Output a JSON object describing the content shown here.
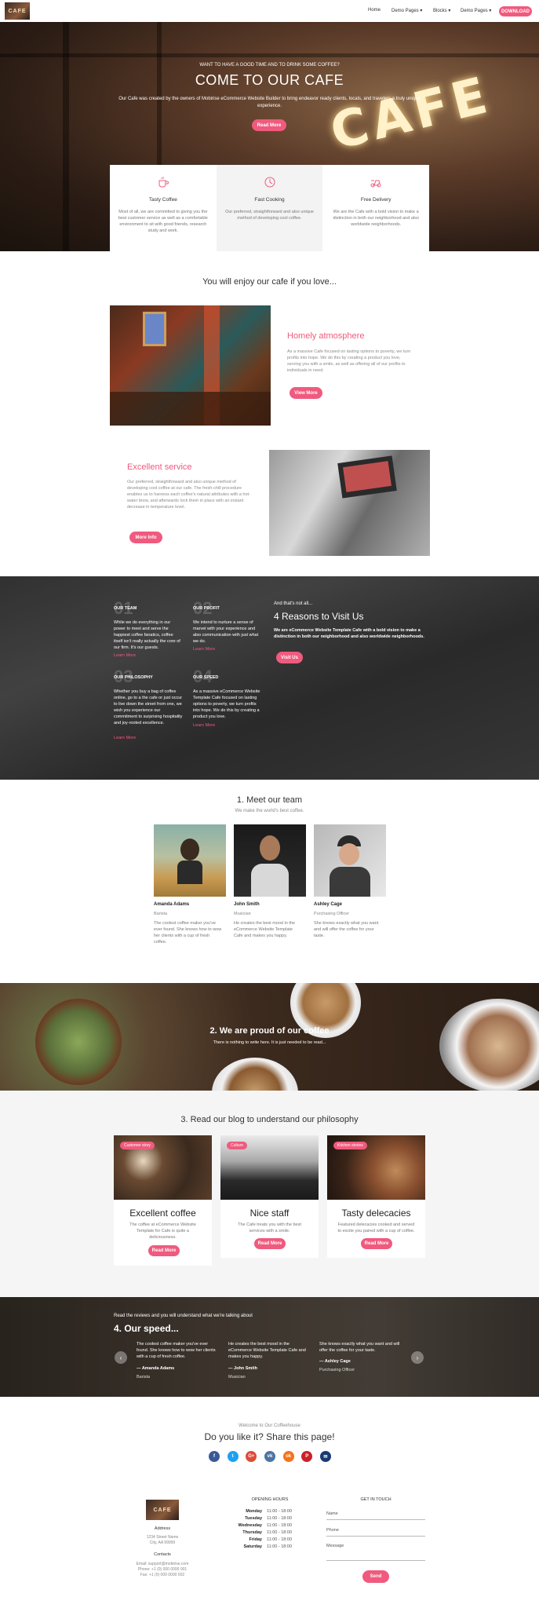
{
  "nav": {
    "logo_text": "CAFE",
    "items": [
      "Home",
      "Demo Pages ▾",
      "Blocks ▾",
      "Demo Pages ▾"
    ],
    "download": "DOWNLOAD"
  },
  "hero": {
    "pre": "WANT TO HAVE A GOOD TIME AND TO DRINK SOME COFFEE?",
    "title": "COME TO OUR CAFE",
    "desc": "Our Cafe was created by the owners of Mobirise eCommerce Website Builder to bring endeavor ready clients, locals, and travelers a truly unique experience.",
    "button": "Read More",
    "sign": "CAFE"
  },
  "features": [
    {
      "title": "Tasty Coffee",
      "text": "Most of all, we are committed to giving you the best customer service as well as a comfortable environment to sit with good friends, research study and work."
    },
    {
      "title": "Fast Cooking",
      "text": "Our preferred, straightforward and also unique method of developing cool coffee."
    },
    {
      "title": "Free Delivery",
      "text": "We are the Cafe with a bold vision to make a distinction in both our neighborhood and also worldwide neighborhoods."
    }
  ],
  "enjoy": {
    "title": "You will enjoy our cafe if you love...",
    "atmos_title": "Homely atmosphere",
    "atmos_text": "As a massive Cafe focused on lasting options to poverty, we turn profits into hope. We do this by creating a product you love, serving you with a smile, as well as offering all of our profits to individuals in need.",
    "atmos_btn": "View More",
    "service_title": "Excellent service",
    "service_text": "Our preferred, straightforward and also unique method of developing cool coffee at our cafe. The fresh-chill procedure enables us to harness each coffee's natural attributes with a hot-water brew, and afterwards lock them in place with an instant decrease in temperature level.",
    "service_btn": "More Info"
  },
  "reasons": {
    "items": [
      {
        "num": "01",
        "head": "OUR TEAM",
        "text": "While we do everything in our power to meet and serve the happiest coffee fanatics, coffee itself isn't really actually the core of our firm. It's our guests.",
        "more": "Learn More"
      },
      {
        "num": "02",
        "head": "OUR PROFIT",
        "text": "We intend to nurture a sense of marvel with your experience and also communication with just what we do.",
        "more": "Learn More"
      },
      {
        "num": "03",
        "head": "OUR PHILOSOPHY",
        "text": "Whether you buy a bag of coffee online, go to a the cafe or just occur to live down the street from one, we wish you experience our commitment to surprising hospitality and joy-rooted excellence.",
        "more": "Learn More"
      },
      {
        "num": "04",
        "head": "OUR SPEED",
        "text": "As a massive eCommerce Website Template Cafe focused on lasting options to poverty, we turn profits into hope. We do this by creating a product you love.",
        "more": "Learn More"
      }
    ],
    "pre": "And that's not all...",
    "title": "4 Reasons to Visit Us",
    "text": "We are eCommerce Website Template Cafe with a bold vision to make a distinction in both our neighborhood and also worldwide neighborhoods.",
    "button": "Visit Us"
  },
  "team": {
    "title": "1. Meet our team",
    "subtitle": "We make the world's best coffee.",
    "members": [
      {
        "name": "Amanda Adams",
        "role": "Barista",
        "text": "The coolest coffee maker you've ever found. She knows how to wow her clients with a cup of fresh coffee."
      },
      {
        "name": "John Smith",
        "role": "Musician",
        "text": "He creates the best mood in the eCommerce Website Template Cafe and makes you happy."
      },
      {
        "name": "Ashley Cage",
        "role": "Purchasing Officer",
        "text": "She knows exactly what you want and will offer the coffee for your taste."
      }
    ]
  },
  "proud": {
    "title": "2. We are proud of our coffee",
    "subtitle": "There is nothing to write here. It is just needed to be read..."
  },
  "blog": {
    "title": "3. Read our blog to understand our philosophy",
    "cards": [
      {
        "tag": "Customer story",
        "title": "Excellent coffee",
        "text": "The coffee at eCommerce Website Template for Cafe is quite a deliciousness.",
        "button": "Read More"
      },
      {
        "tag": "Culture",
        "title": "Nice staff",
        "text": "The Cafe treats you with the best services with a smile.",
        "button": "Read More"
      },
      {
        "tag": "Kitchen stories",
        "title": "Tasty delecacies",
        "text": "Featured delecacies cooked and served to excite you paired with a cup of coffee.",
        "button": "Read More"
      }
    ]
  },
  "speed": {
    "pre": "Read the reviews and you will understand what we're talking about",
    "title": "4. Our speed...",
    "quotes": [
      {
        "text": "The coolest coffee maker you've ever found. She knows how to wow her clients with a cup of fresh coffee.",
        "name": "— Amanda Adams",
        "role": "Barista"
      },
      {
        "text": "He creates the best mood in the eCommerce Website Template Cafe and makes you happy.",
        "name": "— John Smith",
        "role": "Musician"
      },
      {
        "text": "She knows exactly what you want and will offer the coffee for your taste.",
        "name": "— Ashley Cage",
        "role": "Purchasing Officer"
      }
    ]
  },
  "share": {
    "pre": "Welcome to Our Coffeehouse",
    "title": "Do you like it? Share this page!",
    "icons": [
      {
        "name": "facebook-icon",
        "glyph": "f",
        "color": "#3b5998"
      },
      {
        "name": "twitter-icon",
        "glyph": "t",
        "color": "#1da1f2"
      },
      {
        "name": "google-plus-icon",
        "glyph": "G+",
        "color": "#dd4b39"
      },
      {
        "name": "vk-icon",
        "glyph": "vk",
        "color": "#4c75a3"
      },
      {
        "name": "odnoklassniki-icon",
        "glyph": "ok",
        "color": "#f4731c"
      },
      {
        "name": "pinterest-icon",
        "glyph": "P",
        "color": "#cb2027"
      },
      {
        "name": "mail-icon",
        "glyph": "✉",
        "color": "#1b3a73"
      }
    ]
  },
  "footer": {
    "address_label": "Address",
    "address_1": "1234 Street Name",
    "address_2": "City, AA 99999",
    "contacts_label": "Contacts",
    "email": "Email: support@mobirise.com",
    "phone": "Phone: +1 (0) 000 0000 001",
    "fax": "Fax: +1 (0) 000 0000 002",
    "hours_title": "OPENING HOURS",
    "hours": [
      {
        "day": "Monday",
        "time": "11:00 - 18:00"
      },
      {
        "day": "Tuesday",
        "time": "11:00 - 18:00"
      },
      {
        "day": "Wednesday",
        "time": "11:00 - 18:00"
      },
      {
        "day": "Thursday",
        "time": "11:00 - 18:00"
      },
      {
        "day": "Friday",
        "time": "11:00 - 18:00"
      },
      {
        "day": "Saturday",
        "time": "11:00 - 18:00"
      }
    ],
    "touch_title": "GET IN TOUCH",
    "name_placeholder": "Name",
    "phone_placeholder": "Phone",
    "message_placeholder": "Message",
    "send": "Send"
  }
}
